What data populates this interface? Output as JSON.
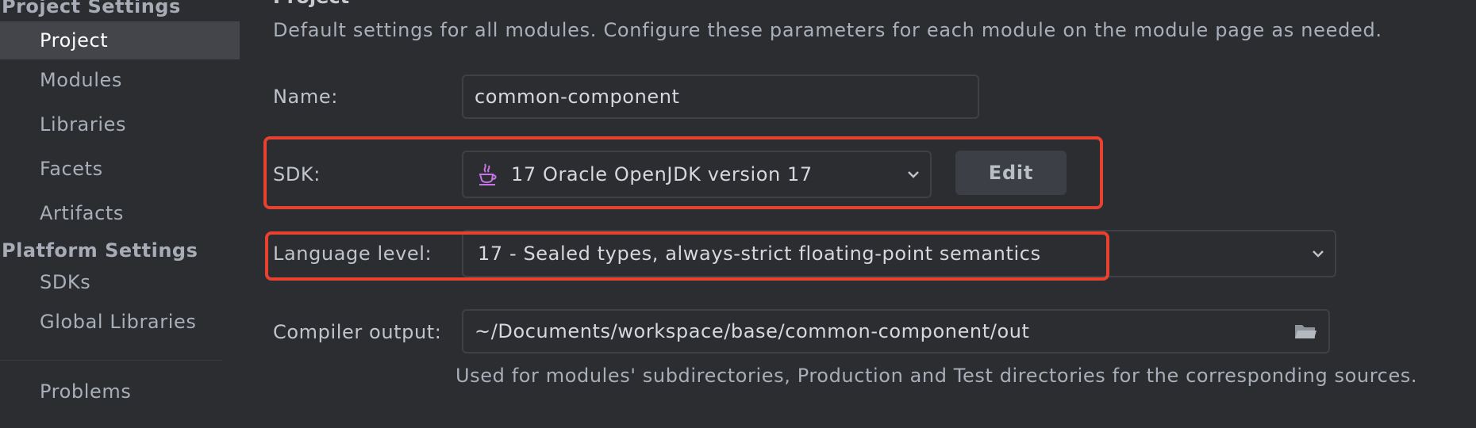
{
  "sidebar": {
    "project_settings_header": "Project Settings",
    "project_items": [
      "Project",
      "Modules",
      "Libraries",
      "Facets",
      "Artifacts"
    ],
    "platform_settings_header": "Platform Settings",
    "platform_items": [
      "SDKs",
      "Global Libraries"
    ],
    "problems": "Problems",
    "selected": "Project"
  },
  "main": {
    "title": "Project",
    "description": "Default settings for all modules. Configure these parameters for each module on the module page as needed.",
    "name": {
      "label": "Name:",
      "value": "common-component"
    },
    "sdk": {
      "label": "SDK:",
      "value": "17 Oracle OpenJDK version 17",
      "icon": "java-icon",
      "edit_label": "Edit"
    },
    "language_level": {
      "label": "Language level:",
      "value": "17 - Sealed types, always-strict floating-point semantics"
    },
    "compiler_output": {
      "label": "Compiler output:",
      "value": "~/Documents/workspace/base/common-component/out",
      "icon": "folder-icon"
    },
    "compiler_hint": "Used for modules' subdirectories, Production and Test directories for the corresponding sources."
  },
  "colors": {
    "background": "#2b2d30",
    "selection": "#43454a",
    "highlight_border": "#e8412f"
  }
}
